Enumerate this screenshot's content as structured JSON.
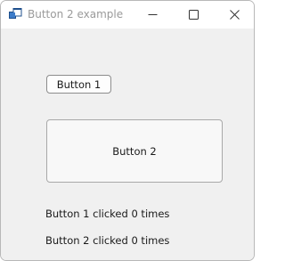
{
  "window": {
    "title": "Button 2 example"
  },
  "buttons": {
    "button1_label": "Button 1",
    "button2_label": "Button 2"
  },
  "status": {
    "button1_text": "Button 1 clicked 0 times",
    "button2_text": "Button 2 clicked 0 times"
  },
  "icons": {
    "app": "app-window-icon",
    "minimize": "minimize-icon",
    "maximize": "maximize-icon",
    "close": "close-icon"
  },
  "colors": {
    "client_background": "#f0f0f0",
    "titlebar_background": "#ffffff",
    "icon_blue": "#1e4f8c"
  }
}
